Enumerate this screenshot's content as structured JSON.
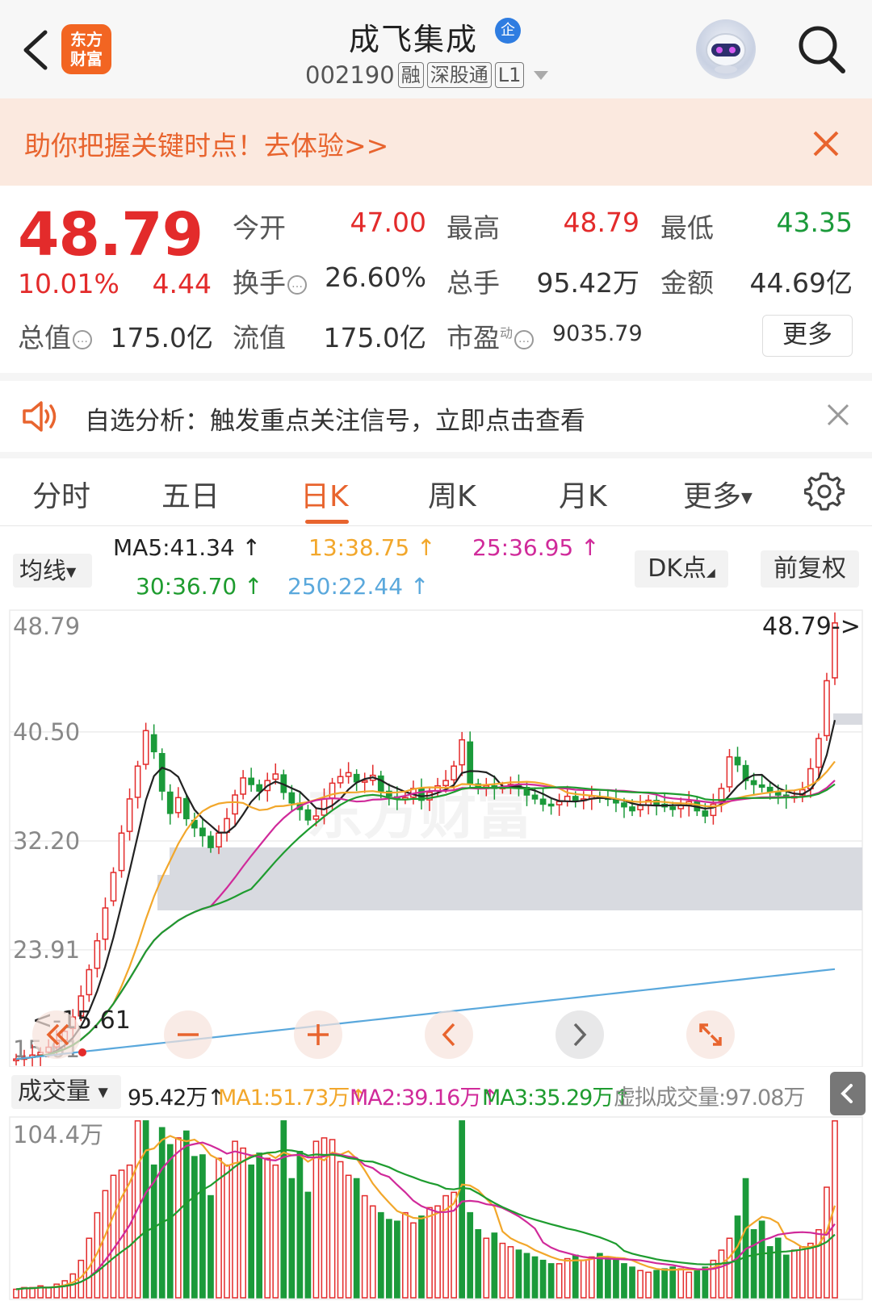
{
  "header": {
    "logo_line1": "东方",
    "logo_line2": "财富",
    "stock_name": "成飞集成",
    "name_badge": "企",
    "stock_code": "002190",
    "tags": [
      "融",
      "深股通",
      "L1"
    ]
  },
  "banner": {
    "text": "助你把握关键时点！去体验>>"
  },
  "quote": {
    "price": "48.79",
    "change_pct": "10.01%",
    "change_amt": "4.44",
    "open_label": "今开",
    "open_value": "47.00",
    "high_label": "最高",
    "high_value": "48.79",
    "low_label": "最低",
    "low_value": "43.35",
    "turnover_label": "换手",
    "turnover_value": "26.60%",
    "volume_label": "总手",
    "volume_value": "95.42万",
    "amount_label": "金额",
    "amount_value": "44.69亿",
    "mktcap_label": "总值",
    "mktcap_value": "175.0亿",
    "float_label": "流值",
    "float_value": "175.0亿",
    "pe_label": "市盈",
    "pe_sup": "动",
    "pe_value": "9035.79",
    "more_label": "更多"
  },
  "analysis": {
    "text": "自选分析：触发重点关注信号，立即点击查看"
  },
  "tabs": [
    "分时",
    "五日",
    "日K",
    "周K",
    "月K",
    "更多"
  ],
  "active_tab": "日K",
  "ma_bar": {
    "selector_label": "均线",
    "ma5": "MA5:41.34",
    "ma13": "13:38.75",
    "ma25": "25:36.95",
    "ma30": "30:36.70",
    "ma250": "250:22.44",
    "dk_label": "DK点",
    "adjust_label": "前复权"
  },
  "colors": {
    "up": "#e32b2b",
    "down": "#1b9a3a",
    "accent": "#e8642e",
    "ma5": "#222222",
    "ma13": "#f2a72b",
    "ma25": "#d02a9a",
    "ma30": "#1e9c2f",
    "ma250": "#5aa8dc"
  },
  "chart_overlay": {
    "last_price_label": "48.79->",
    "low_marker_label": "<-15.61",
    "icons": [
      "fast-back-icon",
      "zoom-out-icon",
      "zoom-in-icon",
      "prev-icon",
      "next-icon",
      "fullscreen-icon"
    ]
  },
  "volume_bar": {
    "selector_label": "成交量",
    "vol": "95.42万",
    "ma1": "MA1:51.73万",
    "ma2": "MA2:39.16万",
    "ma3": "MA3:35.29万",
    "virtual": "虚拟成交量:97.08万"
  },
  "chart_data": [
    {
      "type": "candlestick",
      "title": "日K",
      "ylim": [
        15.61,
        48.79
      ],
      "y_ticks": [
        "48.79",
        "40.50",
        "32.20",
        "23.91",
        "15.61"
      ],
      "last_close": 48.79,
      "low_marker": 15.61,
      "ma": {
        "MA5": 41.34,
        "MA13": 38.75,
        "MA25": 36.95,
        "MA30": 36.7,
        "MA250": 22.44
      },
      "closes": [
        15.6,
        15.7,
        15.9,
        16.1,
        16.5,
        17.0,
        17.7,
        18.8,
        20.4,
        22.4,
        24.6,
        27.1,
        29.8,
        32.8,
        35.4,
        37.9,
        40.6,
        39.0,
        36.0,
        34.3,
        35.5,
        33.9,
        33.2,
        32.6,
        31.7,
        32.8,
        33.9,
        35.7,
        37.0,
        36.5,
        36.0,
        36.8,
        37.3,
        35.9,
        35.1,
        34.6,
        33.8,
        34.1,
        35.4,
        36.6,
        37.1,
        37.4,
        36.7,
        36.8,
        37.2,
        36.0,
        35.6,
        35.4,
        35.5,
        36.2,
        35.3,
        35.9,
        36.4,
        36.8,
        37.9,
        39.9,
        36.6,
        36.3,
        36.4,
        36.2,
        36.3,
        36.5,
        36.3,
        35.7,
        35.4,
        35.0,
        34.9,
        35.2,
        35.6,
        35.3,
        35.4,
        35.6,
        35.5,
        35.4,
        35.1,
        34.8,
        34.5,
        34.9,
        35.3,
        35.0,
        34.8,
        34.6,
        34.9,
        35.2,
        34.5,
        34.1,
        35.0,
        36.2,
        38.6,
        38.0,
        36.8,
        36.5,
        36.3,
        35.9,
        35.7,
        35.5,
        35.6,
        36.1,
        37.7,
        40.0,
        44.4,
        48.8
      ]
    },
    {
      "type": "bar",
      "title": "成交量",
      "ymax_label": "104.4万",
      "unit": "万",
      "values": [
        5,
        6,
        6,
        7,
        6,
        8,
        10,
        14,
        22,
        35,
        50,
        63,
        72,
        75,
        78,
        104,
        104,
        78,
        100,
        90,
        94,
        98,
        83,
        84,
        60,
        82,
        78,
        92,
        88,
        78,
        85,
        82,
        78,
        104,
        70,
        86,
        62,
        92,
        94,
        93,
        80,
        72,
        70,
        60,
        54,
        50,
        46,
        45,
        50,
        44,
        48,
        53,
        54,
        60,
        62,
        104,
        50,
        40,
        35,
        38,
        32,
        30,
        28,
        26,
        24,
        22,
        20,
        20,
        23,
        25,
        22,
        24,
        26,
        24,
        22,
        20,
        18,
        16,
        15,
        16,
        17,
        18,
        17,
        15,
        16,
        18,
        22,
        28,
        35,
        48,
        70,
        40,
        45,
        30,
        35,
        25,
        28,
        30,
        32,
        40,
        65,
        104
      ],
      "up": [
        1,
        1,
        1,
        1,
        1,
        1,
        1,
        1,
        1,
        1,
        1,
        1,
        1,
        1,
        1,
        1,
        0,
        0,
        0,
        0,
        1,
        0,
        0,
        0,
        0,
        1,
        1,
        1,
        1,
        0,
        0,
        1,
        1,
        0,
        0,
        0,
        0,
        1,
        1,
        1,
        1,
        1,
        0,
        1,
        1,
        0,
        0,
        0,
        1,
        1,
        0,
        1,
        1,
        1,
        1,
        0,
        0,
        0,
        1,
        0,
        1,
        1,
        0,
        0,
        0,
        0,
        0,
        1,
        1,
        0,
        1,
        1,
        0,
        0,
        0,
        0,
        0,
        1,
        1,
        0,
        0,
        0,
        1,
        1,
        0,
        0,
        1,
        1,
        1,
        0,
        0,
        0,
        0,
        0,
        0,
        0,
        1,
        1,
        1,
        1,
        1,
        1
      ],
      "ma1": 51.73,
      "ma2": 39.16,
      "ma3": 35.29
    }
  ]
}
